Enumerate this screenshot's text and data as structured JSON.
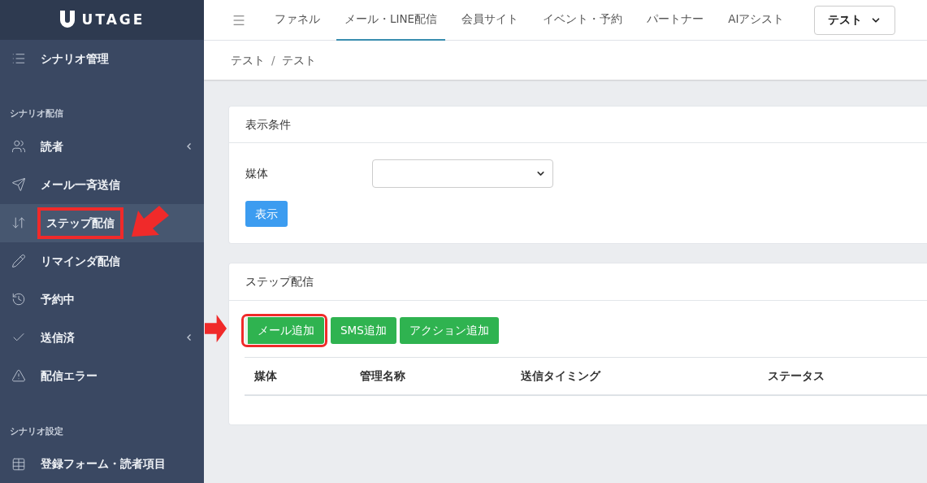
{
  "logo": {
    "text": "UTAGE"
  },
  "sidebar": {
    "items": [
      {
        "kind": "item",
        "label": "シナリオ管理",
        "selected": false,
        "has_submenu": false,
        "highlighted": false
      },
      {
        "kind": "section",
        "label": "シナリオ配信"
      },
      {
        "kind": "item",
        "label": "読者",
        "selected": false,
        "has_submenu": true,
        "highlighted": false
      },
      {
        "kind": "item",
        "label": "メール一斉送信",
        "selected": false,
        "has_submenu": false,
        "highlighted": false
      },
      {
        "kind": "item",
        "label": "ステップ配信",
        "selected": true,
        "has_submenu": false,
        "highlighted": true
      },
      {
        "kind": "item",
        "label": "リマインダ配信",
        "selected": false,
        "has_submenu": false,
        "highlighted": false
      },
      {
        "kind": "item",
        "label": "予約中",
        "selected": false,
        "has_submenu": false,
        "highlighted": false
      },
      {
        "kind": "item",
        "label": "送信済",
        "selected": false,
        "has_submenu": true,
        "highlighted": false
      },
      {
        "kind": "item",
        "label": "配信エラー",
        "selected": false,
        "has_submenu": false,
        "highlighted": false
      },
      {
        "kind": "section",
        "label": "シナリオ設定"
      },
      {
        "kind": "item",
        "label": "登録フォーム・読者項目",
        "selected": false,
        "has_submenu": false,
        "highlighted": false
      }
    ]
  },
  "top_nav": {
    "tabs": [
      {
        "label": "ファネル",
        "selected": false
      },
      {
        "label": "メール・LINE配信",
        "selected": true
      },
      {
        "label": "会員サイト",
        "selected": false
      },
      {
        "label": "イベント・予約",
        "selected": false
      },
      {
        "label": "パートナー",
        "selected": false
      },
      {
        "label": "AIアシスト",
        "selected": false
      }
    ],
    "account_select": "テスト"
  },
  "breadcrumb": {
    "items": [
      "テスト",
      "テスト"
    ],
    "separator": "/"
  },
  "filter_card": {
    "title": "表示条件",
    "field_label": "媒体",
    "submit": "表示"
  },
  "step_card": {
    "title": "ステップ配信",
    "buttons": [
      {
        "label": "メール追加",
        "highlighted": true
      },
      {
        "label": "SMS追加",
        "highlighted": false
      },
      {
        "label": "アクション追加",
        "highlighted": false
      }
    ],
    "table": {
      "columns": [
        "媒体",
        "管理名称",
        "送信タイミング",
        "ステータス"
      ]
    }
  }
}
